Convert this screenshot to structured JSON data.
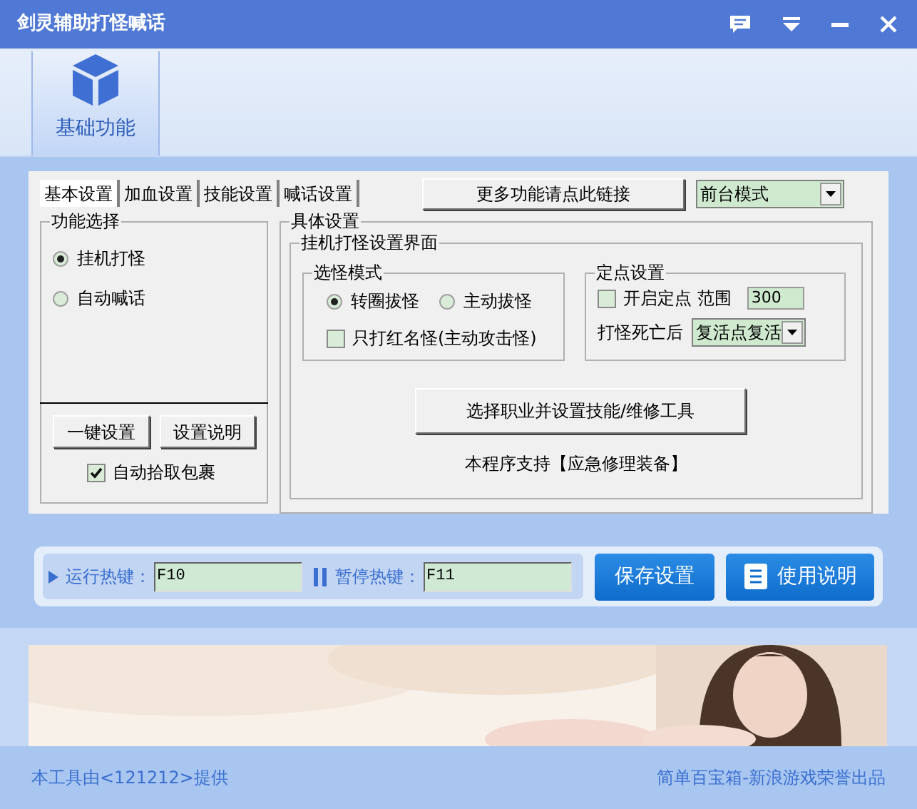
{
  "window": {
    "title": "剑灵辅助打怪喊话"
  },
  "toolbar": [
    {
      "label": "基础功能",
      "selected": true
    }
  ],
  "tabs": [
    {
      "label": "基本设置",
      "selected": true
    },
    {
      "label": "加血设置",
      "selected": false
    },
    {
      "label": "技能设置",
      "selected": false
    },
    {
      "label": "喊话设置",
      "selected": false
    }
  ],
  "more_link_button": "更多功能请点此链接",
  "mode_select": {
    "value": "前台模式"
  },
  "function_group": {
    "title": "功能选择",
    "options": [
      {
        "label": "挂机打怪",
        "selected": true
      },
      {
        "label": "自动喊话",
        "selected": false
      }
    ],
    "buttons": [
      "一键设置",
      "设置说明"
    ],
    "auto_pickup": {
      "label": "自动拾取包裹",
      "checked": true
    }
  },
  "details": {
    "title": "具体设置",
    "subtitle": "挂机打怪设置界面",
    "target_mode": {
      "title": "选怪模式",
      "options": [
        {
          "label": "转圈拔怪",
          "selected": true
        },
        {
          "label": "主动拔怪",
          "selected": false
        }
      ],
      "red_only": {
        "label": "只打红名怪(主动攻击怪)",
        "checked": false
      }
    },
    "fixed_point": {
      "title": "定点设置",
      "enable": {
        "label": "开启定点 范围",
        "checked": false
      },
      "range": "300",
      "death_label": "打怪死亡后",
      "death_select": "复活点复活"
    },
    "profession_button": "选择职业并设置技能/维修工具",
    "note": "本程序支持【应急修理装备】"
  },
  "hotkeys": [
    {
      "kind": "run",
      "label": "运行热键：",
      "value": "F10"
    },
    {
      "kind": "pause",
      "label": "暂停热键：",
      "value": "F11"
    }
  ],
  "actions": [
    {
      "kind": "plain",
      "label": "保存设置"
    },
    {
      "kind": "doc",
      "label": "使用说明"
    }
  ],
  "footer": {
    "left": "本工具由<121212>提供",
    "right": "简单百宝箱-新浪游戏荣誉出品"
  }
}
